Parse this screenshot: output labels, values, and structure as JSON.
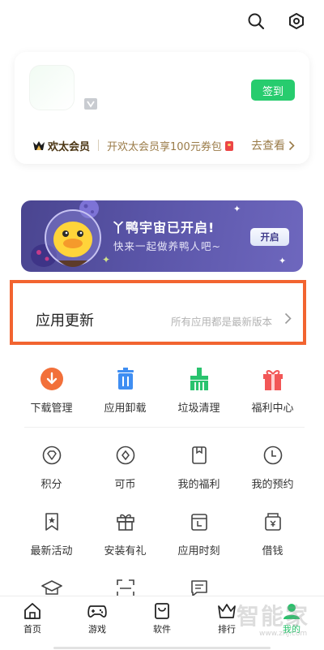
{
  "topbar": {
    "icons": [
      "search-icon",
      "settings-icon"
    ]
  },
  "profile": {
    "signin_label": "签到",
    "vip": {
      "name": "欢太会员",
      "desc": "开欢太会员享100元券包",
      "more": "去查看"
    }
  },
  "banner": {
    "title": "丫鸭宇宙已开启!",
    "subtitle": "快来一起做养鸭人吧~",
    "button": "开启"
  },
  "update": {
    "title": "应用更新",
    "status": "所有应用都是最新版本"
  },
  "tools": [
    {
      "label": "下载管理",
      "icon": "download-icon",
      "color": "#f2703a"
    },
    {
      "label": "应用卸载",
      "icon": "trash-icon",
      "color": "#3f8ef2"
    },
    {
      "label": "垃圾清理",
      "icon": "broom-icon",
      "color": "#29c36e"
    },
    {
      "label": "福利中心",
      "icon": "gift-icon",
      "color": "#f25757"
    }
  ],
  "services_row1": [
    {
      "label": "积分",
      "icon": "diamond-icon"
    },
    {
      "label": "可币",
      "icon": "coin-icon"
    },
    {
      "label": "我的福利",
      "icon": "bookmark-icon"
    },
    {
      "label": "我的预约",
      "icon": "clock-icon"
    }
  ],
  "services_row2": [
    {
      "label": "最新活动",
      "icon": "star-flag-icon"
    },
    {
      "label": "安装有礼",
      "icon": "gift-outline-icon"
    },
    {
      "label": "应用时刻",
      "icon": "calendar-icon"
    },
    {
      "label": "借钱",
      "icon": "wallet-icon"
    }
  ],
  "services_row3_icons": [
    "graduation-cap-icon",
    "scan-icon",
    "message-icon"
  ],
  "tabbar": [
    {
      "label": "首页",
      "icon": "home-icon",
      "active": false
    },
    {
      "label": "游戏",
      "icon": "gamepad-icon",
      "active": false
    },
    {
      "label": "软件",
      "icon": "bag-icon",
      "active": false
    },
    {
      "label": "排行",
      "icon": "crown-icon",
      "active": false
    },
    {
      "label": "我的",
      "icon": "user-icon",
      "active": true
    }
  ],
  "watermark": {
    "main": "智能家",
    "url": "www.znj.com"
  },
  "colors": {
    "accent": "#27cc6e",
    "highlight_border": "#f26430",
    "banner": "#5a55a8"
  }
}
